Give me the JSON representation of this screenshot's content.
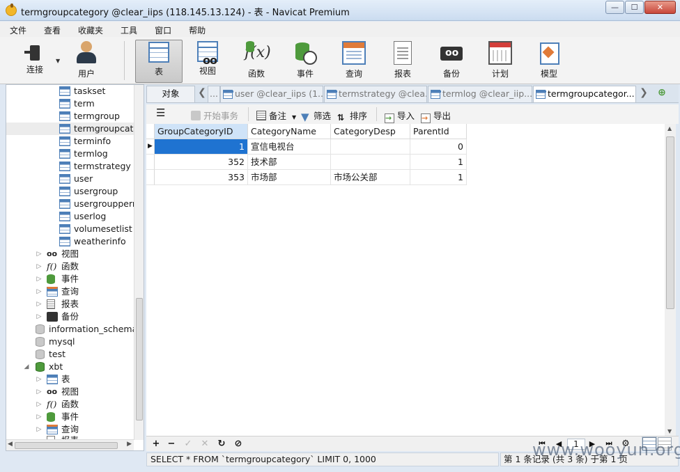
{
  "window": {
    "title": "termgroupcategory @clear_iips (118.145.13.124) - 表 - Navicat Premium",
    "minimize_label": "—",
    "maximize_label": "☐",
    "close_label": "✕"
  },
  "menu": [
    "文件",
    "查看",
    "收藏夹",
    "工具",
    "窗口",
    "帮助"
  ],
  "toolbar": {
    "connect": "连接",
    "user": "用户",
    "table": "表",
    "view": "视图",
    "function": "函数",
    "event": "事件",
    "query": "查询",
    "report": "报表",
    "backup": "备份",
    "schedule": "计划",
    "model": "模型"
  },
  "sidebar": {
    "tables": [
      "taskset",
      "term",
      "termgroup",
      "termgroupcate",
      "terminfo",
      "termlog",
      "termstrategy",
      "user",
      "usergroup",
      "usergrouppern",
      "userlog",
      "volumesetlist",
      "weatherinfo"
    ],
    "selected_table": "termgroupcate",
    "clear_iips_sections": {
      "view": "视图",
      "function": "函数",
      "event": "事件",
      "query": "查询",
      "report": "报表",
      "backup": "备份"
    },
    "databases": [
      "information_schema",
      "mysql",
      "test"
    ],
    "xbt": {
      "name": "xbt",
      "sections": {
        "table": "表",
        "view": "视图",
        "function": "函数",
        "event": "事件",
        "query": "查询",
        "report": "报表"
      }
    }
  },
  "tabs": {
    "objects": "对象",
    "user": "user @clear_iips (1...",
    "termstrategy": "termstrategy @clea...",
    "termlog": "termlog @clear_iip...",
    "termgroupcategory": "termgroupcategor..."
  },
  "subtoolbar": {
    "begin_transaction": "开始事务",
    "memo": "备注",
    "filter": "筛选",
    "sort": "排序",
    "import": "导入",
    "export": "导出"
  },
  "grid": {
    "columns": [
      "GroupCategoryID",
      "CategoryName",
      "CategoryDesp",
      "ParentId"
    ],
    "rows": [
      [
        "1",
        "宣信电视台",
        "",
        "0"
      ],
      [
        "352",
        "技术部",
        "",
        "1"
      ],
      [
        "353",
        "市场部",
        "市场公关部",
        "1"
      ]
    ]
  },
  "navigator": {
    "page": "1"
  },
  "status": {
    "sql": "SELECT * FROM `termgroupcategory` LIMIT 0, 1000",
    "records": "第 1 条记录 (共 3 条) 于第 1 页"
  },
  "watermark": "www.wooyun.org"
}
